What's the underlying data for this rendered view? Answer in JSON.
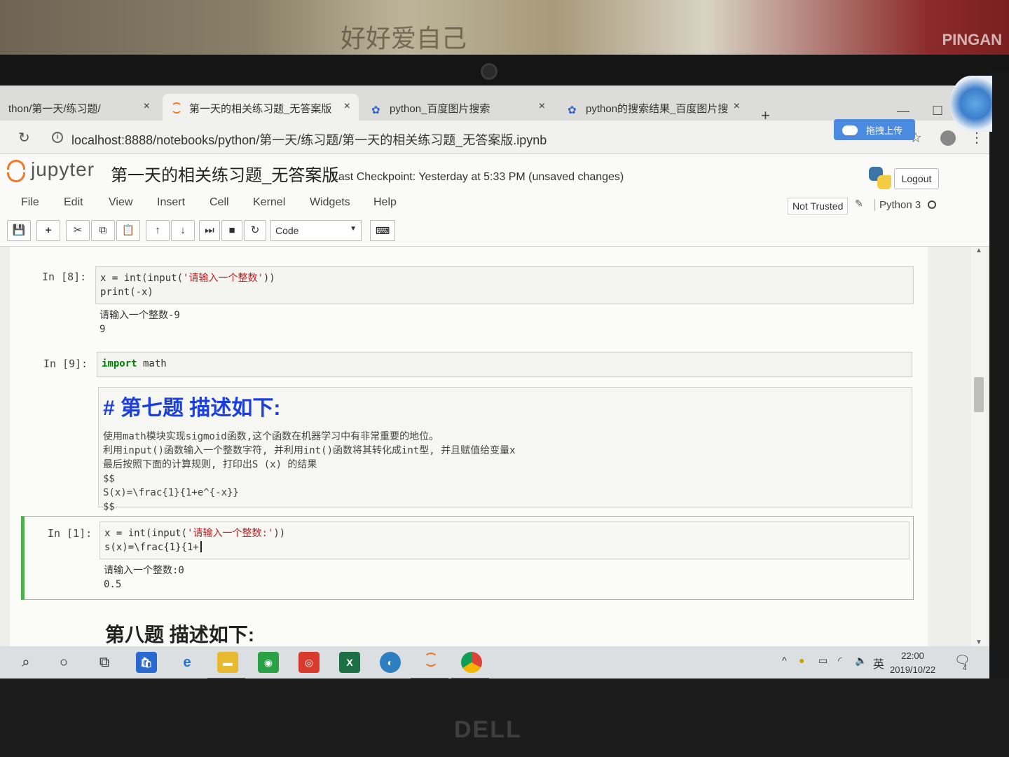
{
  "browser": {
    "tabs": [
      {
        "label": "thon/第一天/练习题/"
      },
      {
        "label": "第一天的相关练习题_无答案版"
      },
      {
        "label": "python_百度图片搜索"
      },
      {
        "label": "python的搜索结果_百度图片搜"
      }
    ],
    "close_glyph": "×",
    "newtab_glyph": "+",
    "upload_label": "拖拽上传",
    "url": "localhost:8888/notebooks/python/第一天/练习题/第一天的相关练习题_无答案版.ipynb"
  },
  "jupyter": {
    "logo_text": "jupyter",
    "notebook_name": "第一天的相关练习题_无答案版",
    "checkpoint": "Last Checkpoint: Yesterday at 5:33 PM (unsaved changes)",
    "logout_label": "Logout",
    "menu": [
      "File",
      "Edit",
      "View",
      "Insert",
      "Cell",
      "Kernel",
      "Widgets",
      "Help"
    ],
    "trust_label": "Not Trusted",
    "kernel_name": "Python 3",
    "cell_type": "Code"
  },
  "cells": {
    "c8": {
      "prompt": "In  [8]:",
      "line1_pre": "x = int(input(",
      "line1_str": "'请输入一个整数'",
      "line1_post": "))",
      "line2": "print(-x)",
      "out1": "请输入一个整数-9",
      "out2": "9"
    },
    "c9": {
      "prompt": "In  [9]:",
      "kw": "import",
      "rest": " math"
    },
    "md": {
      "heading": "# 第七题 描述如下:",
      "lines": [
        "使用math模块实现sigmoid函数,这个函数在机器学习中有非常重要的地位。",
        "利用input()函数输入一个整数字符, 并利用int()函数将其转化成int型, 并且赋值给变量x",
        "最后按照下面的计算规则, 打印出S (x) 的结果",
        "$$",
        "S(x)=\\frac{1}{1+e^{-x}}",
        " $$"
      ]
    },
    "c1": {
      "prompt": "In  [1]:",
      "line1_pre": "x = int(input(",
      "line1_str": "'请输入一个整数:'",
      "line1_post": "))",
      "line2": "s(x)=\\frac{1}{1+",
      "out1": "请输入一个整数:0",
      "out2": "0.5"
    },
    "next_heading": "第八题 描述如下:"
  },
  "taskbar": {
    "ime": "英",
    "time": "22:00",
    "date": "2019/10/22",
    "notif_count": "4"
  },
  "background": {
    "book_text": "好好爱自己",
    "brand_text": "PINGAN",
    "laptop_brand": "DELL"
  }
}
